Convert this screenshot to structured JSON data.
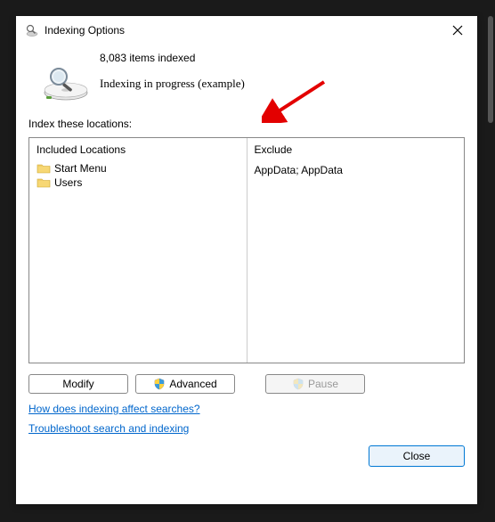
{
  "dialog": {
    "title": "Indexing Options"
  },
  "status": {
    "items_indexed": "8,083 items indexed",
    "progress": "Indexing in progress (example)"
  },
  "section_label": "Index these locations:",
  "columns": {
    "included_header": "Included Locations",
    "exclude_header": "Exclude"
  },
  "locations": [
    {
      "name": "Start Menu",
      "exclude": ""
    },
    {
      "name": "Users",
      "exclude": "AppData; AppData"
    }
  ],
  "buttons": {
    "modify": "Modify",
    "advanced": "Advanced",
    "pause": "Pause",
    "close": "Close"
  },
  "links": {
    "how": "How does indexing affect searches?",
    "troubleshoot": "Troubleshoot search and indexing"
  }
}
